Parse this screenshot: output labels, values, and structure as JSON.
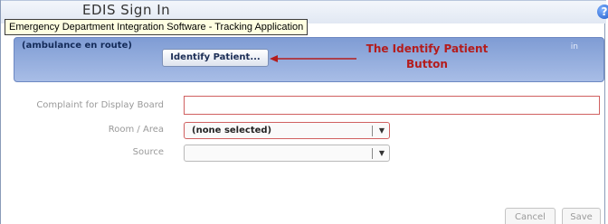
{
  "window": {
    "title": "EDIS Sign In",
    "tooltip": "Emergency Department Integration Software - Tracking Application"
  },
  "header": {
    "status_text": "(ambulance en route)",
    "right_text": "in",
    "identify_button_label": "Identify Patient...",
    "annotation_line1": "The Identify Patient",
    "annotation_line2": "Button",
    "annotation_color": "#b41c1c"
  },
  "form": {
    "complaint_label": "Complaint for Display Board",
    "complaint_value": "",
    "room_label": "Room / Area",
    "room_value": "(none selected)",
    "source_label": "Source",
    "source_value": ""
  },
  "actions": {
    "cancel_label": "Cancel",
    "save_label": "Save"
  },
  "icons": {
    "help": "help-icon",
    "dropdown": "chevron-down-icon",
    "annotation_arrow": "arrow-left-icon"
  }
}
